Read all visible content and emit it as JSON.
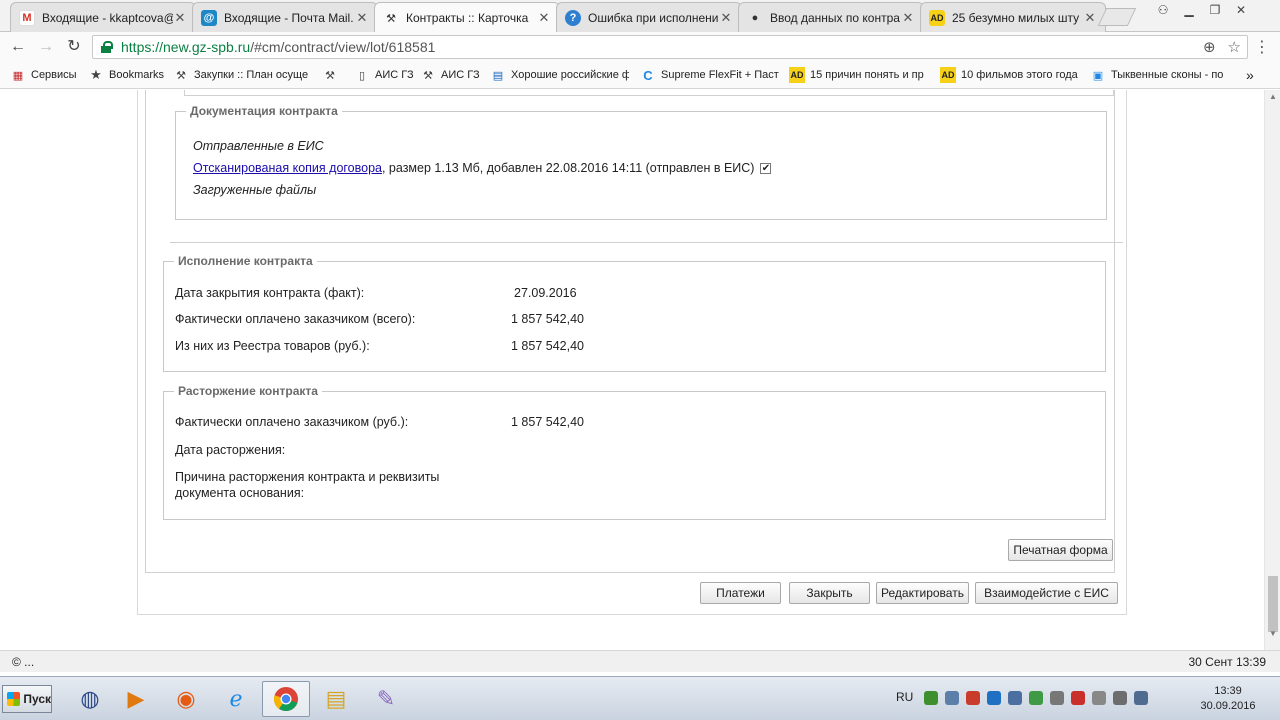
{
  "tabs": [
    {
      "title": "Входящие - kkaptcova@",
      "icon": "M",
      "icon_color": "#d93025",
      "icon_bg": "#ffffff"
    },
    {
      "title": "Входящие - Почта Mail.",
      "icon": "@",
      "icon_color": "#ffffff",
      "icon_bg": "#1e88c7"
    },
    {
      "title": "Контракты :: Карточка",
      "icon": "⚒",
      "icon_color": "#333333",
      "icon_bg": "transparent"
    },
    {
      "title": "Ошибка при исполнени",
      "icon": "?",
      "icon_color": "#ffffff",
      "icon_bg": "#2f7fd0"
    },
    {
      "title": "Ввод данных по контра",
      "icon": "●",
      "icon_color": "#333333",
      "icon_bg": "transparent"
    },
    {
      "title": "25 безумно милых шту",
      "icon": "AD",
      "icon_color": "#222222",
      "icon_bg": "#f7d117"
    }
  ],
  "address": {
    "host": "https://new.gz-spb.ru",
    "path": "/#cm/contract/view/lot/618581"
  },
  "bookmarks": [
    {
      "label": "Сервисы",
      "icon": "▦"
    },
    {
      "label": "Bookmarks",
      "icon": "★"
    },
    {
      "label": "Закупки :: План осуще",
      "icon": "⚒"
    },
    {
      "label": "",
      "icon": "⚒"
    },
    {
      "label": "АИС ГЗ",
      "icon": "▯"
    },
    {
      "label": "АИС ГЗ",
      "icon": "⚒"
    },
    {
      "label": "Хорошие российские ф",
      "icon": "▤"
    },
    {
      "label": "Supreme FlexFit + Паст",
      "icon": "C"
    },
    {
      "label": "15 причин понять и пр",
      "icon": "AD"
    },
    {
      "label": "10 фильмов этого года",
      "icon": "AD"
    },
    {
      "label": "Тыквенные сконы - по",
      "icon": "▣"
    }
  ],
  "bookmarks_overflow": "»",
  "docs": {
    "legend": "Документация контракта",
    "sent_label": "Отправленные в ЕИС",
    "file_link": "Отсканированая копия договора",
    "file_info": ", размер 1.13 Мб, добавлен 22.08.2016 14:11 (отправлен в ЕИС)",
    "file_sent_checked": "✔",
    "uploaded_label": "Загруженные файлы"
  },
  "execution": {
    "legend": "Исполнение контракта",
    "rows": [
      {
        "label": "Дата закрытия контракта (факт):",
        "value": "27.09.2016"
      },
      {
        "label": "Фактически оплачено заказчиком (всего):",
        "value": "1 857 542,40"
      },
      {
        "label": "Из них из Реестра товаров (руб.):",
        "value": "1 857 542,40"
      }
    ]
  },
  "termination": {
    "legend": "Расторжение контракта",
    "paid_label": "Фактически оплачено заказчиком (руб.):",
    "paid_value": "1 857 542,40",
    "date_label": "Дата расторжения:",
    "reason_label_1": "Причина расторжения контракта и реквизиты",
    "reason_label_2": "документа основания:"
  },
  "buttons": {
    "print": "Печатная форма",
    "payments": "Платежи",
    "close": "Закрыть",
    "edit": "Редактировать",
    "eis": "Взаимодейстие с ЕИС"
  },
  "status": {
    "left": "© ...",
    "right": "30 Сент 13:39"
  },
  "taskbar": {
    "start": "Пуск",
    "lang": "RU",
    "time": "13:39",
    "date": "30.09.2016"
  }
}
